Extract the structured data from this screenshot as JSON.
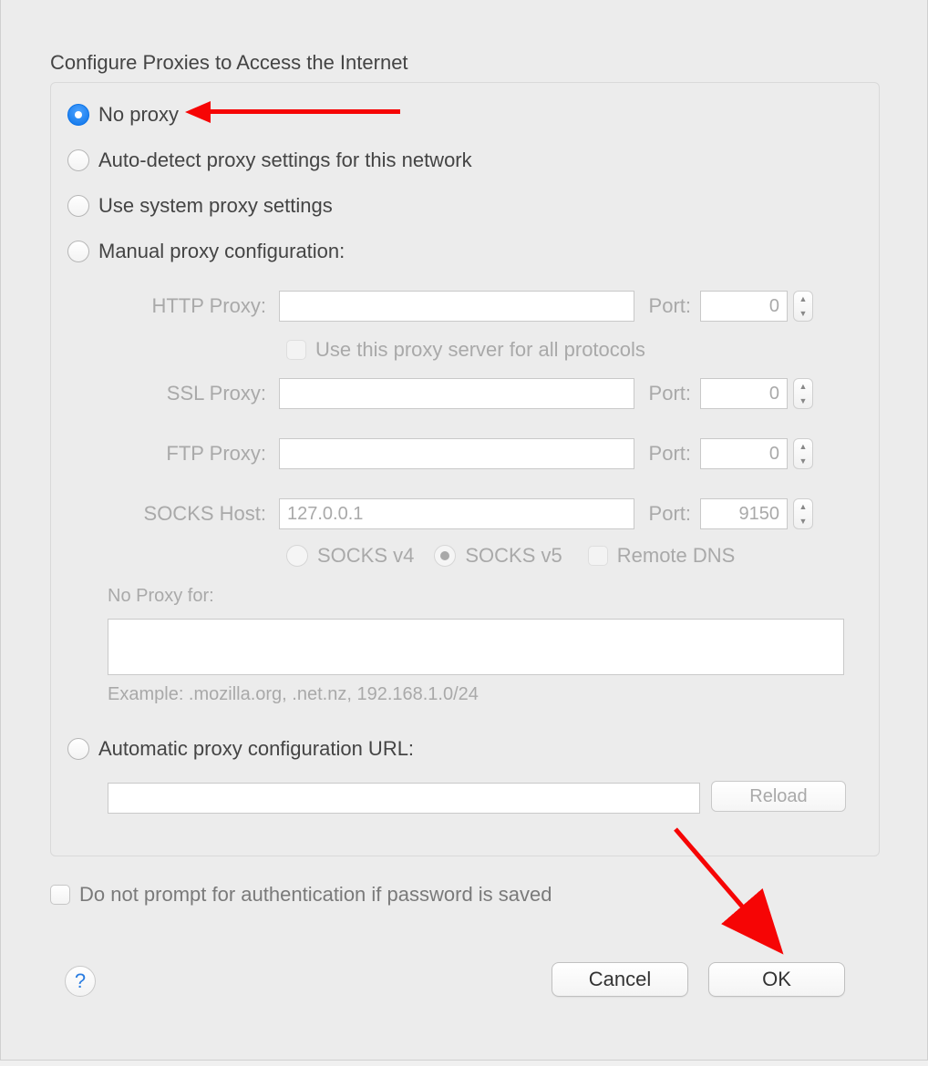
{
  "title": "Configure Proxies to Access the Internet",
  "radios": {
    "no_proxy": "No proxy",
    "auto_detect": "Auto-detect proxy settings for this network",
    "system": "Use system proxy settings",
    "manual": "Manual proxy configuration:",
    "pac": "Automatic proxy configuration URL:"
  },
  "fields": {
    "http_label": "HTTP Proxy:",
    "ssl_label": "SSL Proxy:",
    "ftp_label": "FTP Proxy:",
    "socks_label": "SOCKS Host:",
    "port_label": "Port:",
    "http_value": "",
    "ssl_value": "",
    "ftp_value": "",
    "socks_value": "127.0.0.1",
    "http_port": "0",
    "ssl_port": "0",
    "ftp_port": "0",
    "socks_port": "9150"
  },
  "checks": {
    "use_all": "Use this proxy server for all protocols",
    "remote_dns": "Remote DNS",
    "no_prompt": "Do not prompt for authentication if password is saved"
  },
  "socks_versions": {
    "v4": "SOCKS v4",
    "v5": "SOCKS v5"
  },
  "no_proxy_for_label": "No Proxy for:",
  "no_proxy_for_value": "",
  "example": "Example: .mozilla.org, .net.nz, 192.168.1.0/24",
  "pac_value": "",
  "buttons": {
    "reload": "Reload",
    "cancel": "Cancel",
    "ok": "OK",
    "help": "?"
  }
}
